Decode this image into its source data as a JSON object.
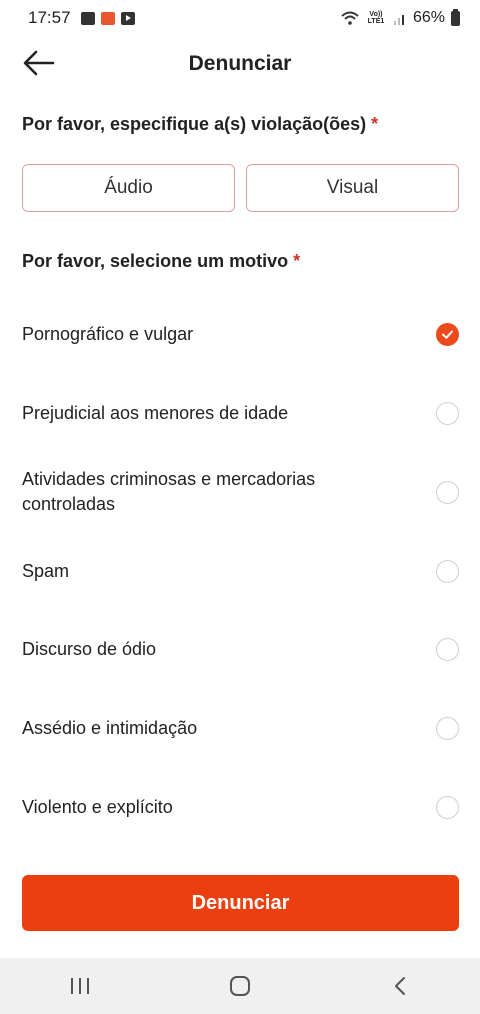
{
  "status_bar": {
    "time": "17:57",
    "network_label": "Vo)) LTE1",
    "battery_percent": "66%"
  },
  "header": {
    "title": "Denunciar",
    "back_icon": "arrow-left-icon"
  },
  "violation_section": {
    "title": "Por favor, especifique a(s) violação(ões)",
    "required_mark": "*",
    "options": [
      {
        "label": "Áudio"
      },
      {
        "label": "Visual"
      }
    ]
  },
  "reason_section": {
    "title": "Por favor, selecione um motivo",
    "required_mark": "*",
    "reasons": [
      {
        "label": "Pornográfico e vulgar",
        "selected": true
      },
      {
        "label": "Prejudicial aos menores de idade",
        "selected": false
      },
      {
        "label": "Atividades criminosas e mercadorias controladas",
        "selected": false
      },
      {
        "label": "Spam",
        "selected": false
      },
      {
        "label": "Discurso de ódio",
        "selected": false
      },
      {
        "label": "Assédio e intimidação",
        "selected": false
      },
      {
        "label": "Violento e explícito",
        "selected": false
      }
    ]
  },
  "submit": {
    "label": "Denunciar"
  },
  "colors": {
    "accent": "#ec3f0f",
    "required": "#d0342c",
    "option_border": "#d9a79b"
  },
  "nav_bar": {
    "icons": [
      "recent-apps-icon",
      "home-icon",
      "back-icon"
    ]
  }
}
